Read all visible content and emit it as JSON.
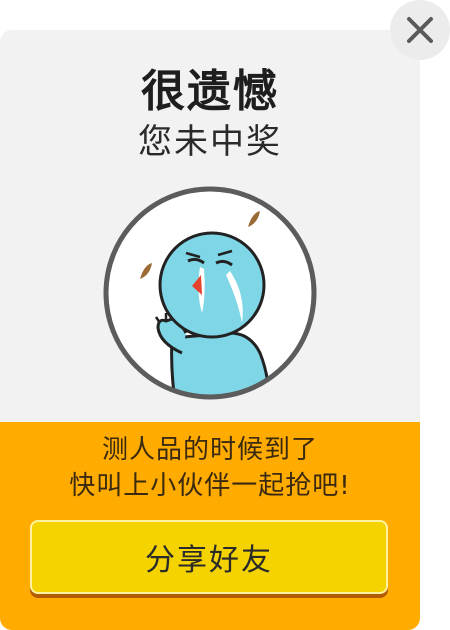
{
  "dialog": {
    "title": "很遗憾",
    "subtitle": "您未中奖",
    "message_line1": "测人品的时候到了",
    "message_line2": "快叫上小伙伴一起抢吧!",
    "share_button_label": "分享好友",
    "close_icon": "close-icon",
    "illustration_icon": "crying-character-icon"
  },
  "colors": {
    "panel_background": "#f2f2f2",
    "footer_background": "#ffab00",
    "button_background": "#f4d300",
    "button_shadow": "#b45a00",
    "character": "#7fd6e6"
  }
}
